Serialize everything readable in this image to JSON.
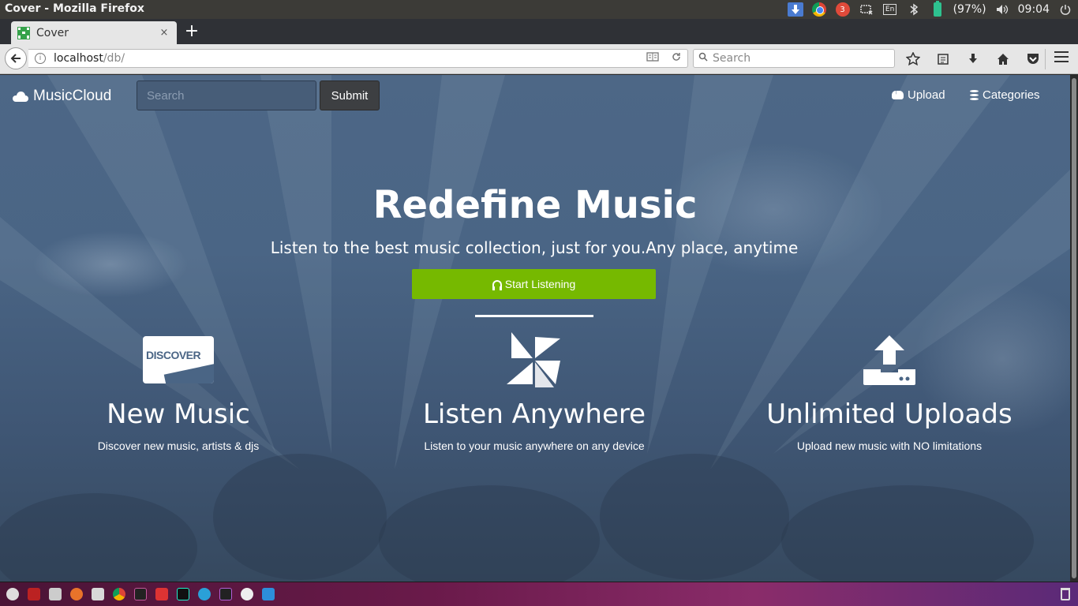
{
  "os_panel": {
    "window_title": "Cover - Mozilla Firefox",
    "badge_count": "3",
    "keyboard_layout": "En",
    "battery": "(97%)",
    "clock": "09:04"
  },
  "browser": {
    "tab": {
      "label": "Cover",
      "close": "×"
    },
    "new_tab": "+",
    "url_host": "localhost",
    "url_path": "/db/",
    "search_placeholder": "Search"
  },
  "site": {
    "brand": "MusicCloud",
    "search_placeholder": "Search",
    "submit_label": "Submit",
    "nav": [
      {
        "label": "Upload",
        "icon": "cloud-upload-icon"
      },
      {
        "label": "Categories",
        "icon": "database-icon"
      }
    ],
    "hero": {
      "title": "Redefine Music",
      "subtitle": "Listen to the best music collection, just for you.Any place, anytime",
      "cta": "Start Listening"
    },
    "features": [
      {
        "icon": "discover-card-icon",
        "icon_text": "DISCOVER",
        "title": "New Music",
        "desc": "Discover new music, artists & djs"
      },
      {
        "icon": "pinwheel-icon",
        "title": "Listen Anywhere",
        "desc": "Listen to your music anywhere on any device"
      },
      {
        "icon": "upload-icon",
        "title": "Unlimited Uploads",
        "desc": "Upload new music with NO limitations"
      }
    ]
  },
  "colors": {
    "hero_bg": "#4a6585",
    "cta_green": "#76b900",
    "taskbar": "#6a1a4a"
  }
}
